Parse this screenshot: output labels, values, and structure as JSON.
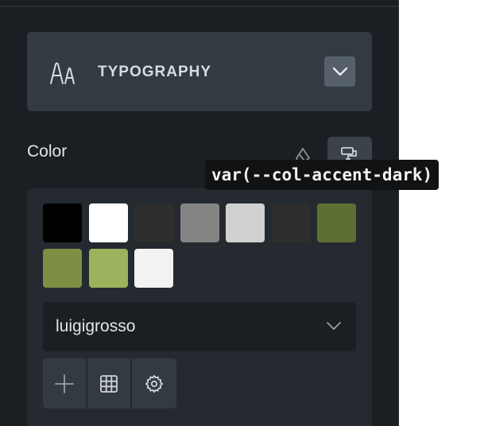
{
  "section": {
    "title": "TYPOGRAPHY",
    "icon": "typography-icon",
    "toggle_icon": "chevron-down-icon"
  },
  "color": {
    "label": "Color",
    "tooltip": "var(--col-accent-dark)",
    "swatches": [
      {
        "color": "#000000"
      },
      {
        "color": "#ffffff"
      },
      {
        "color": "#2e2e2e"
      },
      {
        "color": "#848484"
      },
      {
        "color": "#d0d0d0"
      },
      {
        "color": "#2e2e2e"
      },
      {
        "color": "#5d6f34"
      },
      {
        "color": "#7d8f45"
      },
      {
        "color": "#9ab35c"
      },
      {
        "color": "#f2f2f2"
      }
    ],
    "palette": {
      "selected": "luigigrosso"
    },
    "tools": [
      {
        "icon": "plus-icon"
      },
      {
        "icon": "grid-icon"
      },
      {
        "icon": "gear-icon"
      }
    ]
  }
}
